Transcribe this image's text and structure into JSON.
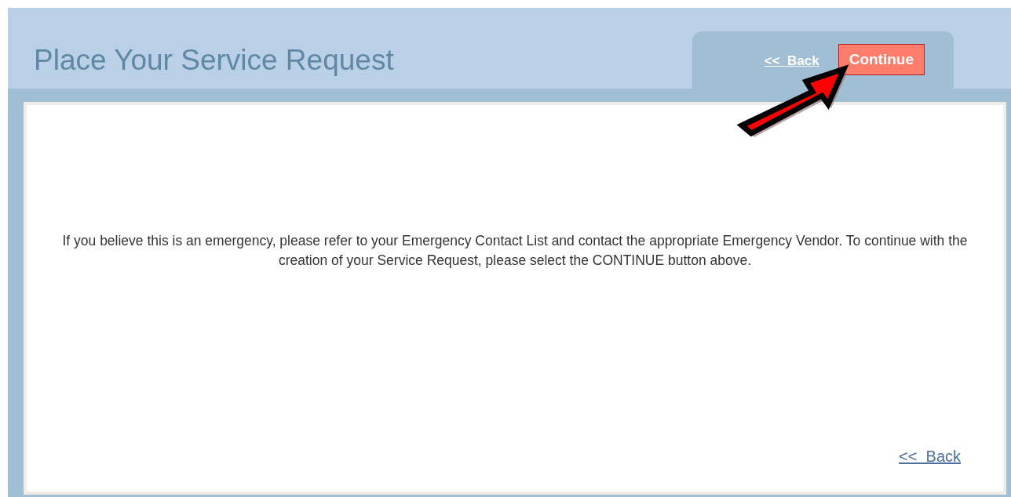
{
  "header": {
    "title": "Place Your Service Request"
  },
  "tab_actions": {
    "back_link": "<<  Back",
    "continue_button": "Continue"
  },
  "message": "If you believe this is an emergency, please refer to your Emergency Contact List and contact the appropriate Emergency Vendor. To continue with the creation of your Service Request, please select the CONTINUE button above.",
  "footer": {
    "back_link": "<<  Back"
  }
}
